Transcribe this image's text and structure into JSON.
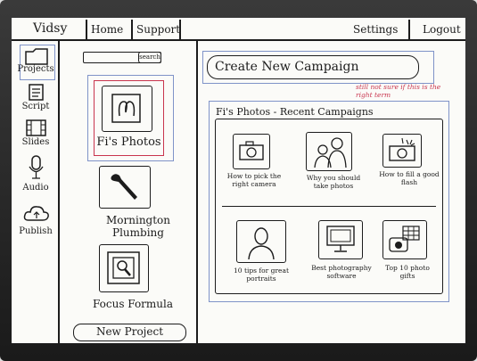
{
  "header": {
    "app_name": "Vidsy",
    "nav_home": "Home",
    "nav_support": "Support",
    "nav_settings": "Settings",
    "nav_logout": "Logout"
  },
  "sidebar": {
    "items": [
      {
        "label": "Projects",
        "icon": "folder-icon"
      },
      {
        "label": "Script",
        "icon": "document-icon"
      },
      {
        "label": "Slides",
        "icon": "film-icon"
      },
      {
        "label": "Audio",
        "icon": "microphone-icon"
      },
      {
        "label": "Publish",
        "icon": "cloud-icon"
      }
    ]
  },
  "projects": {
    "search_label": "search",
    "items": [
      {
        "label": "Fi's Photos",
        "icon": "camera-icon"
      },
      {
        "label": "Mornington Plumbing",
        "icon": "wrench-icon"
      },
      {
        "label": "Focus Formula",
        "icon": "magnifier-icon"
      }
    ],
    "new_project_label": "New Project"
  },
  "main": {
    "create_campaign_label": "Create New Campaign",
    "annotation": "still not sure if this is the right term",
    "recent_title": "Fi's Photos - Recent Campaigns",
    "campaigns": [
      {
        "caption": "How to pick the right camera",
        "icon": "camera-icon"
      },
      {
        "caption": "Why you should take photos",
        "icon": "people-icon"
      },
      {
        "caption": "How to fill a good flash",
        "icon": "flash-camera-icon"
      },
      {
        "caption": "10 tips for great portraits",
        "icon": "portrait-icon"
      },
      {
        "caption": "Best photography software",
        "icon": "monitor-icon"
      },
      {
        "caption": "Top 10 photo gifts",
        "icon": "gift-icon"
      }
    ]
  },
  "colors": {
    "ink": "#1c1c1c",
    "highlight_red": "#c9354e",
    "selection_blue": "#7f93c8",
    "frame": "#2a2a2a"
  }
}
